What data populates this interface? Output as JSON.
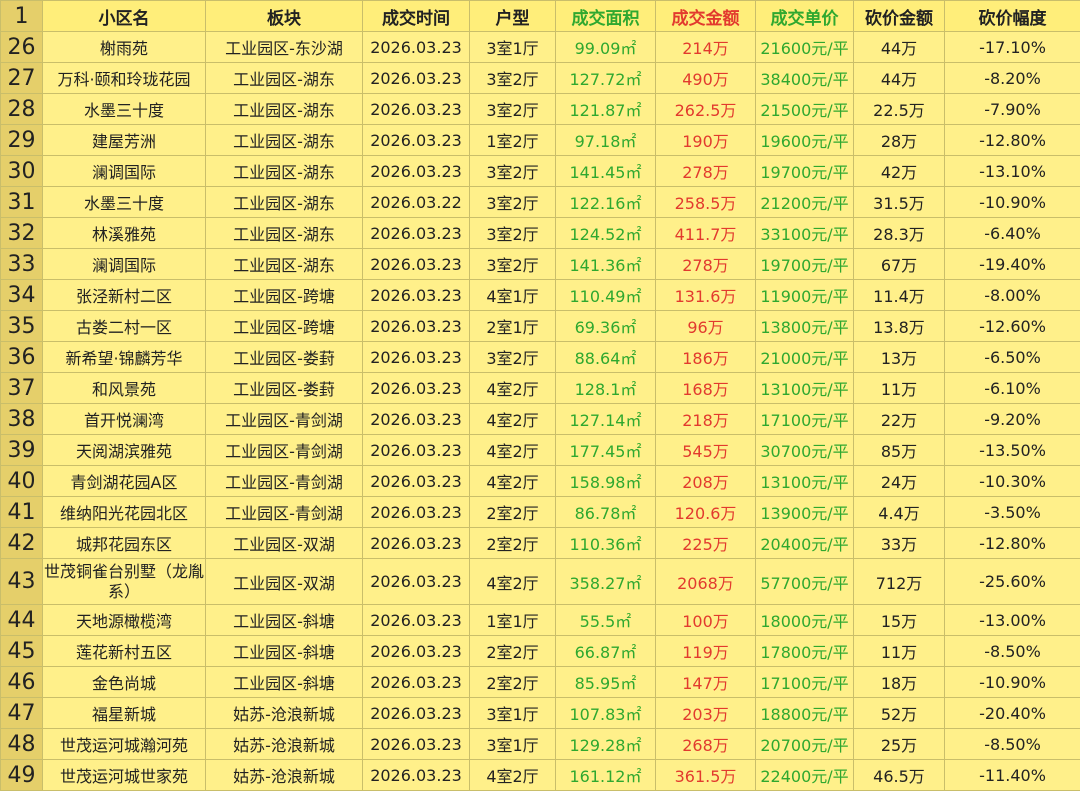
{
  "colors": {
    "green": "#2FA82F",
    "red": "#E23A2E",
    "background": "#FFF08A"
  },
  "header": {
    "rownum": "1",
    "cols": [
      "小区名",
      "板块",
      "成交时间",
      "户型",
      "成交面积",
      "成交金额",
      "成交单价",
      "砍价金额",
      "砍价幅度"
    ]
  },
  "rows": [
    {
      "no": "26",
      "name": "榭雨苑",
      "area": "工业园区-东沙湖",
      "date": "2026.03.23",
      "layout": "3室1厅",
      "size": "99.09㎡",
      "price": "214万",
      "unit": "21600元/平",
      "cut": "44万",
      "pct": "-17.10%"
    },
    {
      "no": "27",
      "name": "万科·颐和玲珑花园",
      "area": "工业园区-湖东",
      "date": "2026.03.23",
      "layout": "3室2厅",
      "size": "127.72㎡",
      "price": "490万",
      "unit": "38400元/平",
      "cut": "44万",
      "pct": "-8.20%"
    },
    {
      "no": "28",
      "name": "水墨三十度",
      "area": "工业园区-湖东",
      "date": "2026.03.23",
      "layout": "3室2厅",
      "size": "121.87㎡",
      "price": "262.5万",
      "unit": "21500元/平",
      "cut": "22.5万",
      "pct": "-7.90%"
    },
    {
      "no": "29",
      "name": "建屋芳洲",
      "area": "工业园区-湖东",
      "date": "2026.03.23",
      "layout": "1室2厅",
      "size": "97.18㎡",
      "price": "190万",
      "unit": "19600元/平",
      "cut": "28万",
      "pct": "-12.80%"
    },
    {
      "no": "30",
      "name": "澜调国际",
      "area": "工业园区-湖东",
      "date": "2026.03.23",
      "layout": "3室2厅",
      "size": "141.45㎡",
      "price": "278万",
      "unit": "19700元/平",
      "cut": "42万",
      "pct": "-13.10%"
    },
    {
      "no": "31",
      "name": "水墨三十度",
      "area": "工业园区-湖东",
      "date": "2026.03.22",
      "layout": "3室2厅",
      "size": "122.16㎡",
      "price": "258.5万",
      "unit": "21200元/平",
      "cut": "31.5万",
      "pct": "-10.90%"
    },
    {
      "no": "32",
      "name": "林溪雅苑",
      "area": "工业园区-湖东",
      "date": "2026.03.23",
      "layout": "3室2厅",
      "size": "124.52㎡",
      "price": "411.7万",
      "unit": "33100元/平",
      "cut": "28.3万",
      "pct": "-6.40%"
    },
    {
      "no": "33",
      "name": "澜调国际",
      "area": "工业园区-湖东",
      "date": "2026.03.23",
      "layout": "3室2厅",
      "size": "141.36㎡",
      "price": "278万",
      "unit": "19700元/平",
      "cut": "67万",
      "pct": "-19.40%"
    },
    {
      "no": "34",
      "name": "张泾新村二区",
      "area": "工业园区-跨塘",
      "date": "2026.03.23",
      "layout": "4室1厅",
      "size": "110.49㎡",
      "price": "131.6万",
      "unit": "11900元/平",
      "cut": "11.4万",
      "pct": "-8.00%"
    },
    {
      "no": "35",
      "name": "古娄二村一区",
      "area": "工业园区-跨塘",
      "date": "2026.03.23",
      "layout": "2室1厅",
      "size": "69.36㎡",
      "price": "96万",
      "unit": "13800元/平",
      "cut": "13.8万",
      "pct": "-12.60%"
    },
    {
      "no": "36",
      "name": "新希望·锦麟芳华",
      "area": "工业园区-娄葑",
      "date": "2026.03.23",
      "layout": "3室2厅",
      "size": "88.64㎡",
      "price": "186万",
      "unit": "21000元/平",
      "cut": "13万",
      "pct": "-6.50%"
    },
    {
      "no": "37",
      "name": "和风景苑",
      "area": "工业园区-娄葑",
      "date": "2026.03.23",
      "layout": "4室2厅",
      "size": "128.1㎡",
      "price": "168万",
      "unit": "13100元/平",
      "cut": "11万",
      "pct": "-6.10%"
    },
    {
      "no": "38",
      "name": "首开悦澜湾",
      "area": "工业园区-青剑湖",
      "date": "2026.03.23",
      "layout": "4室2厅",
      "size": "127.14㎡",
      "price": "218万",
      "unit": "17100元/平",
      "cut": "22万",
      "pct": "-9.20%"
    },
    {
      "no": "39",
      "name": "天阅湖滨雅苑",
      "area": "工业园区-青剑湖",
      "date": "2026.03.23",
      "layout": "4室2厅",
      "size": "177.45㎡",
      "price": "545万",
      "unit": "30700元/平",
      "cut": "85万",
      "pct": "-13.50%"
    },
    {
      "no": "40",
      "name": "青剑湖花园A区",
      "area": "工业园区-青剑湖",
      "date": "2026.03.23",
      "layout": "4室2厅",
      "size": "158.98㎡",
      "price": "208万",
      "unit": "13100元/平",
      "cut": "24万",
      "pct": "-10.30%"
    },
    {
      "no": "41",
      "name": "维纳阳光花园北区",
      "area": "工业园区-青剑湖",
      "date": "2026.03.23",
      "layout": "2室2厅",
      "size": "86.78㎡",
      "price": "120.6万",
      "unit": "13900元/平",
      "cut": "4.4万",
      "pct": "-3.50%"
    },
    {
      "no": "42",
      "name": "城邦花园东区",
      "area": "工业园区-双湖",
      "date": "2026.03.23",
      "layout": "2室2厅",
      "size": "110.36㎡",
      "price": "225万",
      "unit": "20400元/平",
      "cut": "33万",
      "pct": "-12.80%"
    },
    {
      "no": "43",
      "name": "世茂铜雀台别墅（龙胤系）",
      "area": "工业园区-双湖",
      "date": "2026.03.23",
      "layout": "4室2厅",
      "size": "358.27㎡",
      "price": "2068万",
      "unit": "57700元/平",
      "cut": "712万",
      "pct": "-25.60%"
    },
    {
      "no": "44",
      "name": "天地源橄榄湾",
      "area": "工业园区-斜塘",
      "date": "2026.03.23",
      "layout": "1室1厅",
      "size": "55.5㎡",
      "price": "100万",
      "unit": "18000元/平",
      "cut": "15万",
      "pct": "-13.00%"
    },
    {
      "no": "45",
      "name": "莲花新村五区",
      "area": "工业园区-斜塘",
      "date": "2026.03.23",
      "layout": "2室2厅",
      "size": "66.87㎡",
      "price": "119万",
      "unit": "17800元/平",
      "cut": "11万",
      "pct": "-8.50%"
    },
    {
      "no": "46",
      "name": "金色尚城",
      "area": "工业园区-斜塘",
      "date": "2026.03.23",
      "layout": "2室2厅",
      "size": "85.95㎡",
      "price": "147万",
      "unit": "17100元/平",
      "cut": "18万",
      "pct": "-10.90%"
    },
    {
      "no": "47",
      "name": "福星新城",
      "area": "姑苏-沧浪新城",
      "date": "2026.03.23",
      "layout": "3室1厅",
      "size": "107.83㎡",
      "price": "203万",
      "unit": "18800元/平",
      "cut": "52万",
      "pct": "-20.40%"
    },
    {
      "no": "48",
      "name": "世茂运河城瀚河苑",
      "area": "姑苏-沧浪新城",
      "date": "2026.03.23",
      "layout": "3室1厅",
      "size": "129.28㎡",
      "price": "268万",
      "unit": "20700元/平",
      "cut": "25万",
      "pct": "-8.50%"
    },
    {
      "no": "49",
      "name": "世茂运河城世家苑",
      "area": "姑苏-沧浪新城",
      "date": "2026.03.23",
      "layout": "4室2厅",
      "size": "161.12㎡",
      "price": "361.5万",
      "unit": "22400元/平",
      "cut": "46.5万",
      "pct": "-11.40%"
    }
  ]
}
